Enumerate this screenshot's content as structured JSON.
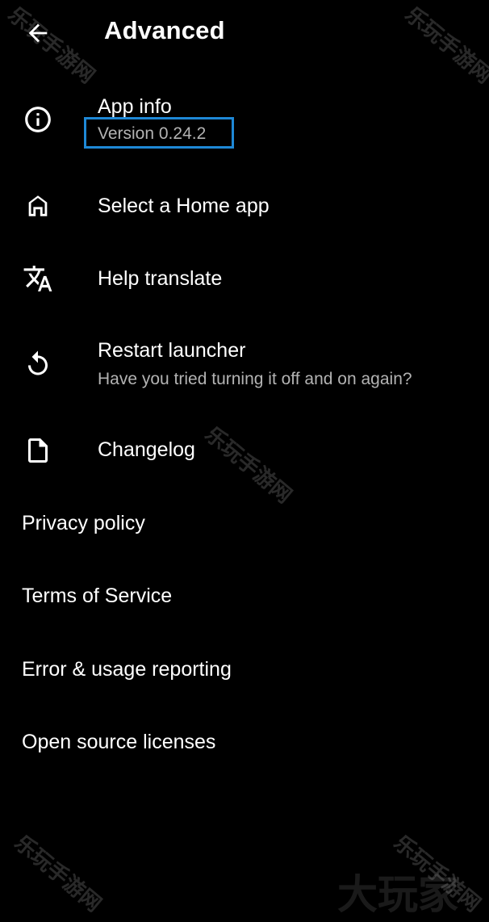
{
  "header": {
    "title": "Advanced",
    "back_icon": "arrow-left-icon"
  },
  "items": [
    {
      "icon": "info-icon",
      "label": "App info",
      "subtitle": "Version 0.24.2"
    },
    {
      "icon": "home-icon",
      "label": "Select a Home app"
    },
    {
      "icon": "translate-icon",
      "label": "Help translate"
    },
    {
      "icon": "restart-icon",
      "label": "Restart launcher",
      "subtitle": "Have you tried turning it off and on again?"
    },
    {
      "icon": "document-icon",
      "label": "Changelog"
    },
    {
      "label": "Privacy policy"
    },
    {
      "label": "Terms of Service"
    },
    {
      "label": "Error & usage reporting"
    },
    {
      "label": "Open source licenses"
    }
  ],
  "highlight_color": "#1e88d6",
  "watermarks": {
    "small": "乐玩手游网",
    "large": "大玩家"
  }
}
